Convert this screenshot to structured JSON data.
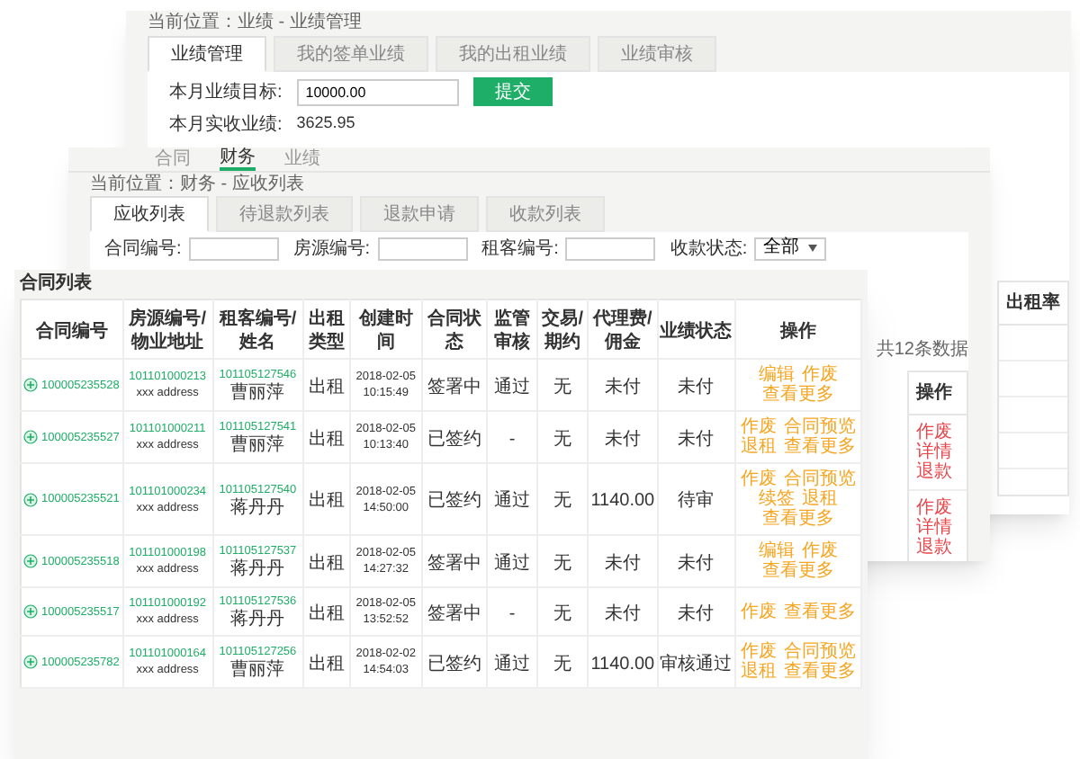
{
  "back_window": {
    "breadcrumb": "当前位置：业绩 - 业绩管理",
    "tabs": [
      {
        "label": "业绩管理",
        "selected": true
      },
      {
        "label": "我的签单业绩",
        "selected": false
      },
      {
        "label": "我的出租业绩",
        "selected": false
      },
      {
        "label": "业绩审核",
        "selected": false
      }
    ],
    "target_label": "本月业绩目标:",
    "target_value": "10000.00",
    "submit_button": "提交",
    "actual_label": "本月实收业绩:",
    "actual_value": "3625.95",
    "table_header": "出租率"
  },
  "middle_window": {
    "nav": [
      {
        "label": "合同",
        "selected": false
      },
      {
        "label": "财务",
        "selected": true
      },
      {
        "label": "业绩",
        "selected": false
      }
    ],
    "breadcrumb": "当前位置：财务 - 应收列表",
    "tabs": [
      {
        "label": "应收列表",
        "selected": true
      },
      {
        "label": "待退款列表",
        "selected": false
      },
      {
        "label": "退款申请",
        "selected": false
      },
      {
        "label": "收款列表",
        "selected": false
      }
    ],
    "filters": [
      {
        "kind": "input",
        "label": "合同编号:"
      },
      {
        "kind": "input",
        "label": "房源编号:"
      },
      {
        "kind": "input",
        "label": "租客编号:"
      },
      {
        "kind": "select",
        "label": "收款状态:",
        "value": "全部"
      }
    ],
    "summary": "共12条数据",
    "table_header": "操作",
    "table_rows": [
      [
        "作废",
        "详情",
        "退款"
      ],
      [
        "作废",
        "详情",
        "退款"
      ]
    ]
  },
  "contract_list": {
    "title": "合同列表",
    "columns": [
      "合同编号",
      "房源编号/物业地址",
      "租客编号/姓名",
      "出租类型",
      "创建时间",
      "合同状态",
      "监管审核",
      "交易/期约",
      "代理费/佣金",
      "业绩状态",
      "操作"
    ],
    "rows": [
      {
        "contract_no": "100005235528",
        "house_no": "101101000213",
        "address": "xxx address",
        "tenant_no": "101105127546",
        "tenant_name": "曹丽萍",
        "type": "出租",
        "created_date": "2018-02-05",
        "created_time": "10:15:49",
        "status": "签署中",
        "review": "通过",
        "deal": "无",
        "fee": "未付",
        "performance": "未付",
        "actions": [
          "编辑",
          "作废",
          "查看更多"
        ]
      },
      {
        "contract_no": "100005235527",
        "house_no": "101101000211",
        "address": "xxx address",
        "tenant_no": "101105127541",
        "tenant_name": "曹丽萍",
        "type": "出租",
        "created_date": "2018-02-05",
        "created_time": "10:13:40",
        "status": "已签约",
        "review": "-",
        "deal": "无",
        "fee": "未付",
        "performance": "未付",
        "actions": [
          "作废",
          "合同预览",
          "退租",
          "查看更多"
        ]
      },
      {
        "contract_no": "100005235521",
        "house_no": "101101000234",
        "address": "xxx address",
        "tenant_no": "101105127540",
        "tenant_name": "蒋丹丹",
        "type": "出租",
        "created_date": "2018-02-05",
        "created_time": "14:50:00",
        "status": "已签约",
        "review": "通过",
        "deal": "无",
        "fee": "1140.00",
        "performance": "待审",
        "actions": [
          "作废",
          "合同预览",
          "续签",
          "退租",
          "查看更多"
        ]
      },
      {
        "contract_no": "100005235518",
        "house_no": "101101000198",
        "address": "xxx address",
        "tenant_no": "101105127537",
        "tenant_name": "蒋丹丹",
        "type": "出租",
        "created_date": "2018-02-05",
        "created_time": "14:27:32",
        "status": "签署中",
        "review": "通过",
        "deal": "无",
        "fee": "未付",
        "performance": "未付",
        "actions": [
          "编辑",
          "作废",
          "查看更多"
        ]
      },
      {
        "contract_no": "100005235517",
        "house_no": "101101000192",
        "address": "xxx address",
        "tenant_no": "101105127536",
        "tenant_name": "蒋丹丹",
        "type": "出租",
        "created_date": "2018-02-05",
        "created_time": "13:52:52",
        "status": "签署中",
        "review": "-",
        "deal": "无",
        "fee": "未付",
        "performance": "未付",
        "actions": [
          "作废",
          "查看更多"
        ]
      },
      {
        "contract_no": "100005235782",
        "house_no": "101101000164",
        "address": "xxx address",
        "tenant_no": "101105127256",
        "tenant_name": "曹丽萍",
        "type": "出租",
        "created_date": "2018-02-02",
        "created_time": "14:54:03",
        "status": "已签约",
        "review": "通过",
        "deal": "无",
        "fee": "1140.00",
        "performance": "审核通过",
        "actions": [
          "作废",
          "合同预览",
          "退租",
          "查看更多"
        ]
      }
    ]
  }
}
